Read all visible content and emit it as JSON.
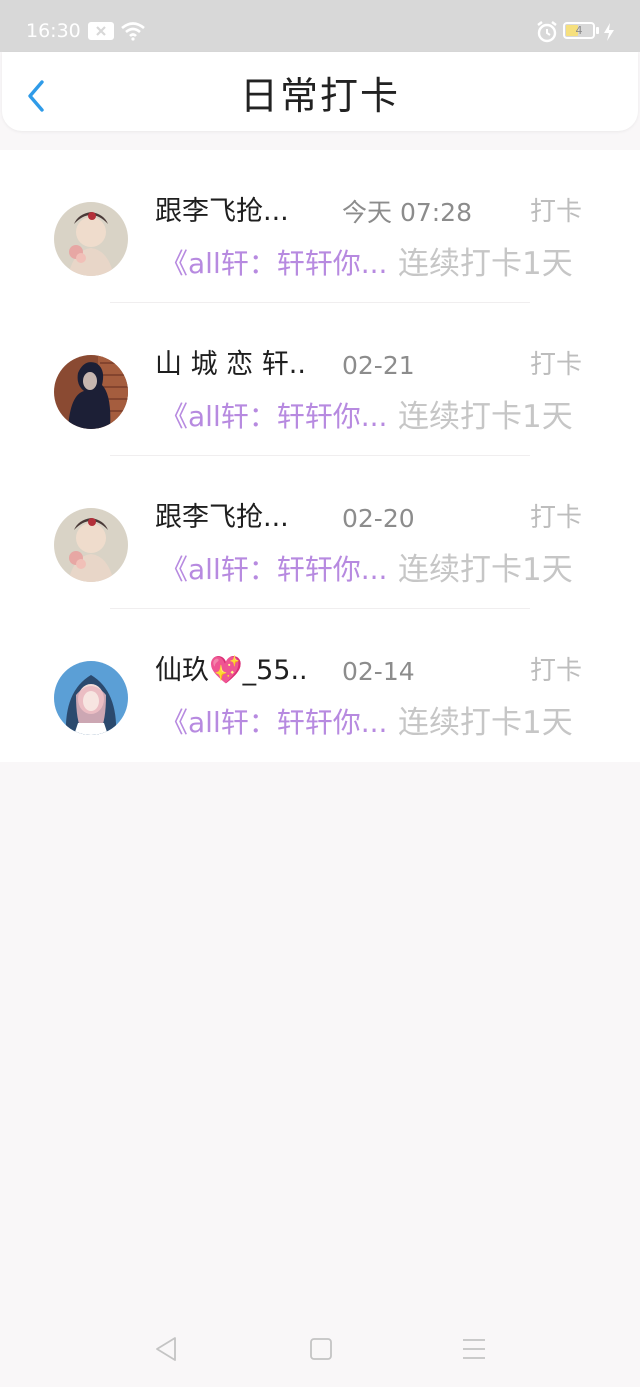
{
  "status_bar": {
    "time": "16:30",
    "battery_level": "4",
    "icons": [
      "notification-icon",
      "wifi-icon",
      "alarm-icon",
      "battery-icon",
      "charging-icon"
    ]
  },
  "header": {
    "title": "日常打卡",
    "back_icon": "chevron-left-icon"
  },
  "colors": {
    "accent": "#2f9be8",
    "link": "#b78ae0",
    "muted": "#c6c6c6"
  },
  "items": [
    {
      "name": "跟李飞抢...",
      "time": "今天 07:28",
      "tag": "打卡",
      "link": "《all轩：轩轩你...",
      "streak": "连续打卡1天"
    },
    {
      "name": "山 城 恋 轩...",
      "time": "02-21",
      "tag": "打卡",
      "link": "《all轩：轩轩你...",
      "streak": "连续打卡1天"
    },
    {
      "name": "跟李飞抢...",
      "time": "02-20",
      "tag": "打卡",
      "link": "《all轩：轩轩你...",
      "streak": "连续打卡1天"
    },
    {
      "name": "仙玖💖_55...",
      "time": "02-14",
      "tag": "打卡",
      "link": "《all轩：轩轩你...",
      "streak": "连续打卡1天"
    }
  ],
  "nav": {
    "icons": [
      "back-triangle-icon",
      "home-square-icon",
      "menu-lines-icon"
    ]
  }
}
